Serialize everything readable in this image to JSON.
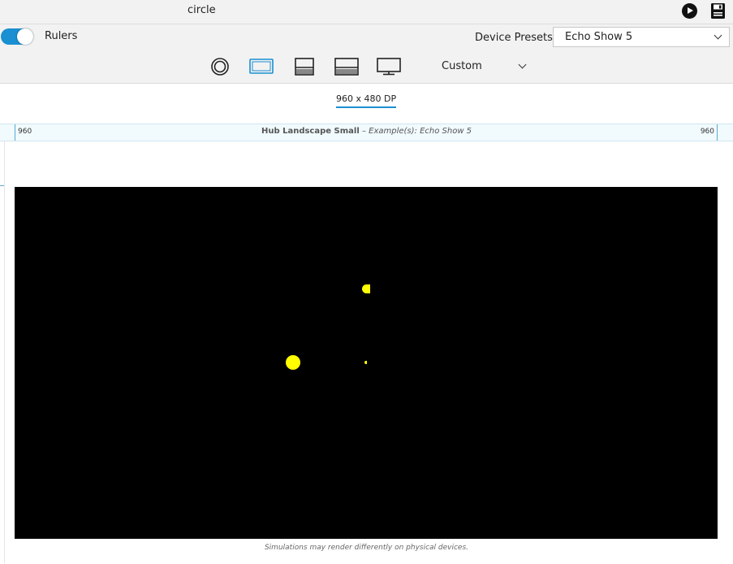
{
  "app": {
    "title": "circle"
  },
  "toolbar_top": {
    "play_icon": "play-icon",
    "save_icon": "save-icon"
  },
  "rulers": {
    "label": "Rulers",
    "enabled": true
  },
  "device_presets": {
    "label": "Device Presets",
    "selected": "Echo Show 5"
  },
  "device_types": {
    "icons": [
      "round-device-icon",
      "landscape-hub-icon",
      "small-screen-icon",
      "medium-screen-icon",
      "tv-icon"
    ],
    "selected_index": 1,
    "custom_label": "Custom"
  },
  "dimensions": {
    "label": "960 x 480 DP"
  },
  "ruler": {
    "left_value": "960",
    "right_value": "960",
    "profile_name": "Hub Landscape Small",
    "separator": " – ",
    "example_text": "Example(s): Echo Show 5"
  },
  "viewport": {
    "background": "#000000",
    "dot_color": "#ffff00"
  },
  "footer": {
    "note": "Simulations may render differently on physical devices."
  }
}
